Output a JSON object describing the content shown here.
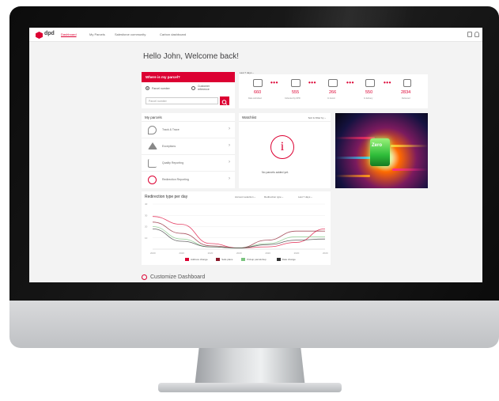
{
  "app": {
    "logo_text": "dpd",
    "brand_color": "#dc0032",
    "nav": [
      "Dashboard",
      "My Parcels",
      "Salesforce community",
      "Carbon dashboard"
    ],
    "active_nav": "Dashboard",
    "top_icons": [
      "bookmark-icon",
      "bell-icon"
    ]
  },
  "greeting": "Hello John, Welcome back!",
  "where_is_my_parcel": {
    "title": "Where is my parcel?",
    "options": [
      "Parcel number",
      "Customer reference"
    ],
    "selected": "Parcel number",
    "placeholder": "Parcel number",
    "button_icon": "search-icon"
  },
  "stats": {
    "period_label": "Last 7 days ~",
    "items": [
      {
        "value": "660",
        "label": "Data submitted",
        "icon": "data-icon"
      },
      {
        "value": "555",
        "label": "Collected by DPD",
        "icon": "collected-icon"
      },
      {
        "value": "266",
        "label": "In transit",
        "icon": "truck-icon"
      },
      {
        "value": "550",
        "label": "In delivery",
        "icon": "courier-icon"
      },
      {
        "value": "2834",
        "label": "Delivered",
        "icon": "delivered-icon"
      }
    ]
  },
  "my_parcels": {
    "title": "My parcels",
    "items": [
      {
        "label": "Track & Trace",
        "icon": "location-pin-icon"
      },
      {
        "label": "Exceptions",
        "icon": "warning-icon"
      },
      {
        "label": "Quality Reporting",
        "icon": "bar-chart-icon"
      },
      {
        "label": "Redirection Reporting",
        "icon": "redirect-icon"
      }
    ]
  },
  "watchlist": {
    "title": "Watchlist",
    "sort_label": "Sort & Filter by ~",
    "empty_text": "No parcels added yet."
  },
  "promo": {
    "label": "Zero"
  },
  "redirection": {
    "title": "Redirection type per day",
    "selects": [
      "Account selection ~",
      "Redirection type ~",
      "Last 7 days ~"
    ],
    "chart_data": {
      "type": "line",
      "x": [
        "2020",
        "2020",
        "2020",
        "2020",
        "2020",
        "2020",
        "2020"
      ],
      "ylim": [
        0,
        40
      ],
      "y_ticks": [
        "40",
        "30",
        "20",
        "10"
      ],
      "series": [
        {
          "name": "Address change",
          "color": "#dc0032",
          "values": [
            29,
            22,
            5,
            1,
            2,
            6,
            18
          ]
        },
        {
          "name": "Safe place",
          "color": "#8b1a2b",
          "values": [
            24,
            14,
            3,
            1,
            8,
            16,
            16
          ]
        },
        {
          "name": "Pickup parcelshop",
          "color": "#7bc47f",
          "values": [
            20,
            9,
            2,
            1,
            5,
            11,
            11
          ]
        },
        {
          "name": "Date change",
          "color": "#333333",
          "values": [
            18,
            7,
            2,
            1,
            4,
            8,
            9
          ]
        }
      ]
    }
  },
  "customize_label": "Customize Dashboard"
}
